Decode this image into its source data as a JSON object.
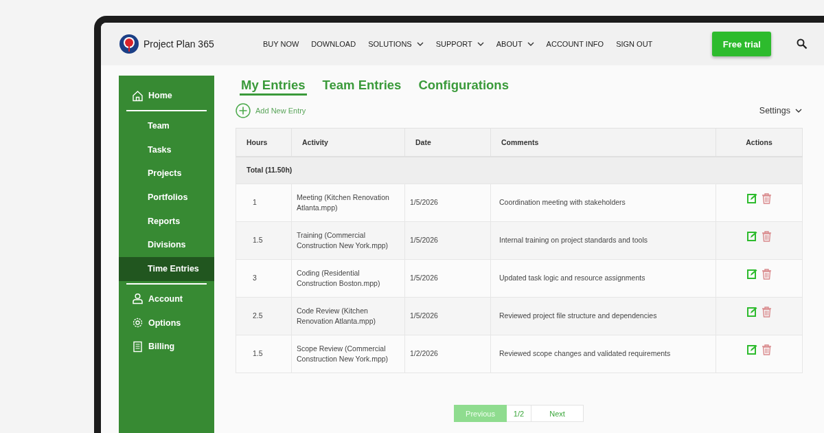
{
  "header": {
    "brand": "Project Plan 365",
    "nav": [
      {
        "label": "BUY NOW",
        "dropdown": false
      },
      {
        "label": "DOWNLOAD",
        "dropdown": false
      },
      {
        "label": "SOLUTIONS",
        "dropdown": true
      },
      {
        "label": "SUPPORT",
        "dropdown": true
      },
      {
        "label": "ABOUT",
        "dropdown": true
      },
      {
        "label": "ACCOUNT INFO",
        "dropdown": false
      },
      {
        "label": "SIGN OUT",
        "dropdown": false
      }
    ],
    "cta": "Free trial"
  },
  "sidebar": {
    "groups": [
      {
        "items": [
          {
            "label": "Home",
            "kind": "main",
            "selected": false
          }
        ]
      },
      {
        "items": [
          {
            "label": "Team",
            "kind": "sub",
            "selected": false
          },
          {
            "label": "Tasks",
            "kind": "sub",
            "selected": false
          },
          {
            "label": "Projects",
            "kind": "sub",
            "selected": false
          },
          {
            "label": "Portfolios",
            "kind": "sub",
            "selected": false
          },
          {
            "label": "Reports",
            "kind": "sub",
            "selected": false
          },
          {
            "label": "Divisions",
            "kind": "sub",
            "selected": false
          },
          {
            "label": "Time Entries",
            "kind": "sub",
            "selected": true
          }
        ]
      },
      {
        "items": [
          {
            "label": "Account",
            "kind": "main",
            "selected": false
          },
          {
            "label": "Options",
            "kind": "main",
            "selected": false
          },
          {
            "label": "Billing",
            "kind": "main",
            "selected": false
          }
        ]
      }
    ]
  },
  "tabs": [
    {
      "label": "My Entries",
      "selected": true
    },
    {
      "label": "Team Entries",
      "selected": false
    },
    {
      "label": "Configurations",
      "selected": false
    }
  ],
  "add_button": "Add New Entry",
  "settings": "Settings",
  "table": {
    "columns": [
      "Hours",
      "Activity",
      "Date",
      "Comments",
      "Actions"
    ],
    "total": "Total (11.50h)",
    "rows": [
      {
        "hours": "1",
        "activity": "Meeting (Kitchen Renovation Atlanta.mpp)",
        "date": "1/5/2026",
        "comments": "Coordination meeting with stakeholders"
      },
      {
        "hours": "1.5",
        "activity": "Training (Commercial Construction New York.mpp)",
        "date": "1/5/2026",
        "comments": "Internal training on project standards and tools"
      },
      {
        "hours": "3",
        "activity": "Coding (Residential Construction Boston.mpp)",
        "date": "1/5/2026",
        "comments": "Updated task logic and resource assignments"
      },
      {
        "hours": "2.5",
        "activity": "Code Review (Kitchen Renovation Atlanta.mpp)",
        "date": "1/5/2026",
        "comments": "Reviewed project file structure and dependencies"
      },
      {
        "hours": "1.5",
        "activity": "Scope Review (Commercial Construction New York.mpp)",
        "date": "1/2/2026",
        "comments": "Reviewed scope changes and validated requirements"
      }
    ]
  },
  "pagination": {
    "previous": {
      "label": "Previous",
      "disabled": true
    },
    "page": "1/2",
    "next": {
      "label": "Next",
      "disabled": false
    }
  }
}
